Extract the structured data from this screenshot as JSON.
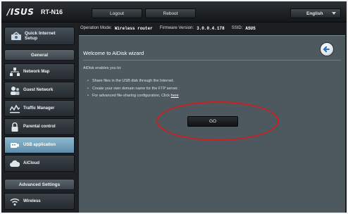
{
  "header": {
    "brand": "/ISUS",
    "model": "RT-N16",
    "logout_label": "Logout",
    "reboot_label": "Reboot",
    "language": "English"
  },
  "info_bar": {
    "op_mode_label": "Operation Mode:",
    "op_mode_value": "Wireless router",
    "firmware_label": "Firmware Version:",
    "firmware_value": "3.0.0.4.178",
    "ssid_label": "SSID:",
    "ssid_value": "ASUS"
  },
  "sidebar": {
    "quick_setup_label": "Quick Internet Setup",
    "general_header": "General",
    "advanced_header": "Advanced Settings",
    "items": [
      {
        "label": "Network Map",
        "icon": "network-map-icon"
      },
      {
        "label": "Guest Network",
        "icon": "guest-network-icon"
      },
      {
        "label": "Traffic Manager",
        "icon": "traffic-manager-icon"
      },
      {
        "label": "Parental control",
        "icon": "lock-icon"
      },
      {
        "label": "USB application",
        "icon": "usb-icon",
        "active": true
      },
      {
        "label": "AiCloud",
        "icon": "cloud-icon"
      }
    ],
    "advanced_items": [
      {
        "label": "Wireless",
        "icon": "wifi-icon"
      }
    ]
  },
  "panel": {
    "title": "Welcome to AiDisk wizard",
    "intro": "AiDisk enables you to:",
    "bullets": [
      "Share files in the USB disk through the Internet.",
      "Create your own domain name for the FTP server.",
      "For advanced file-sharing configuration, Click"
    ],
    "link_text": "here",
    "go_label": "GO"
  },
  "colors": {
    "panel_bg": "#4d585f",
    "active_item": "#8eb9d2",
    "annotation": "#cc1f1f"
  }
}
